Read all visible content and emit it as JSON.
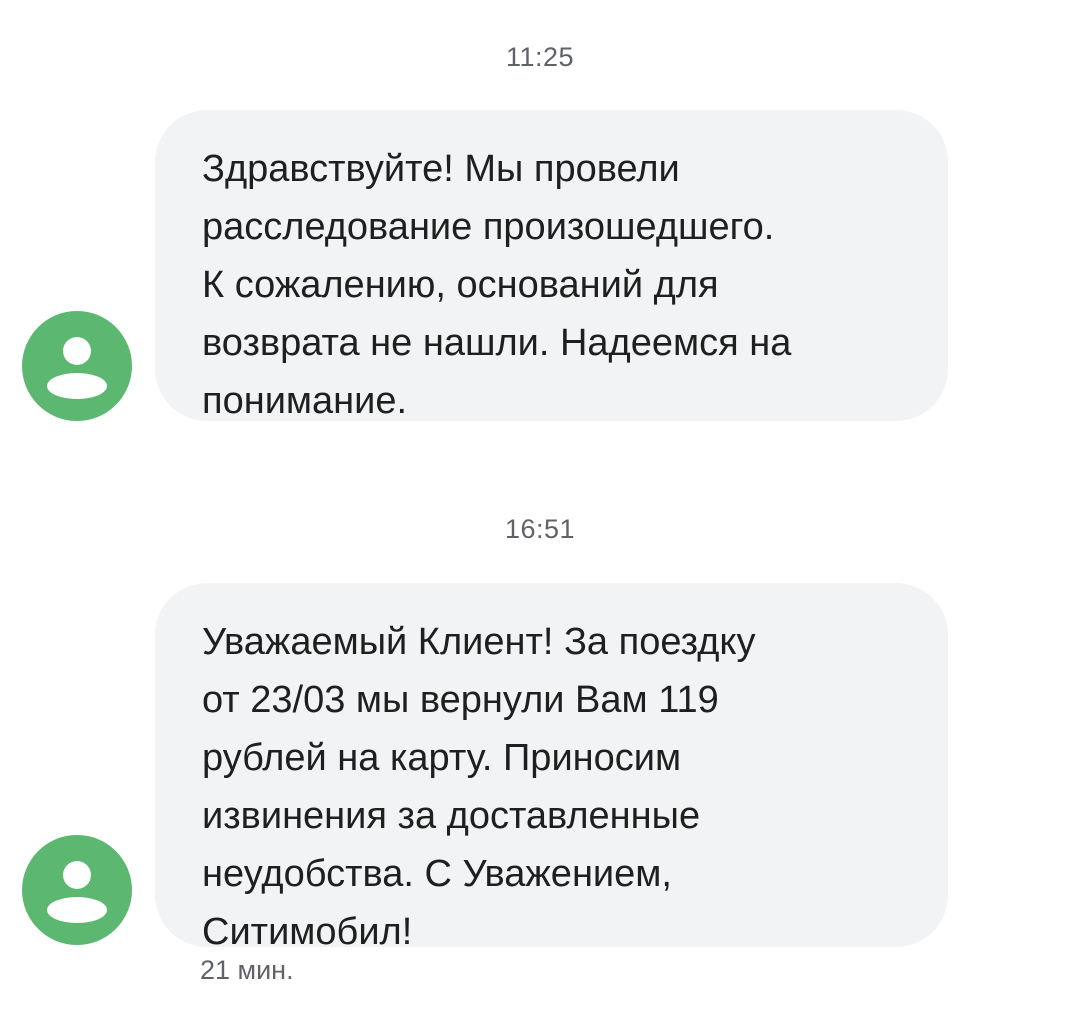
{
  "conversation": {
    "messages": [
      {
        "time": "11:25",
        "text": "Здравствуйте! Мы провели\nрасследование произошедшего.\nК сожалению, оснований для\nвозврата не нашли. Надеемся на\nпонимание.",
        "avatar_icon": "person-icon"
      },
      {
        "time": "16:51",
        "text": "Уважаемый Клиент! За поездку\nот 23/03 мы вернули Вам 119\nрублей на карту. Приносим\nизвинения за доставленные\nнеудобства. С Уважением,\nСитимобил!",
        "avatar_icon": "person-icon",
        "status": "21 мин."
      }
    ]
  },
  "colors": {
    "avatar_bg": "#5cb870",
    "bubble_bg": "#f1f3f4",
    "meta_text": "#5f6368"
  }
}
